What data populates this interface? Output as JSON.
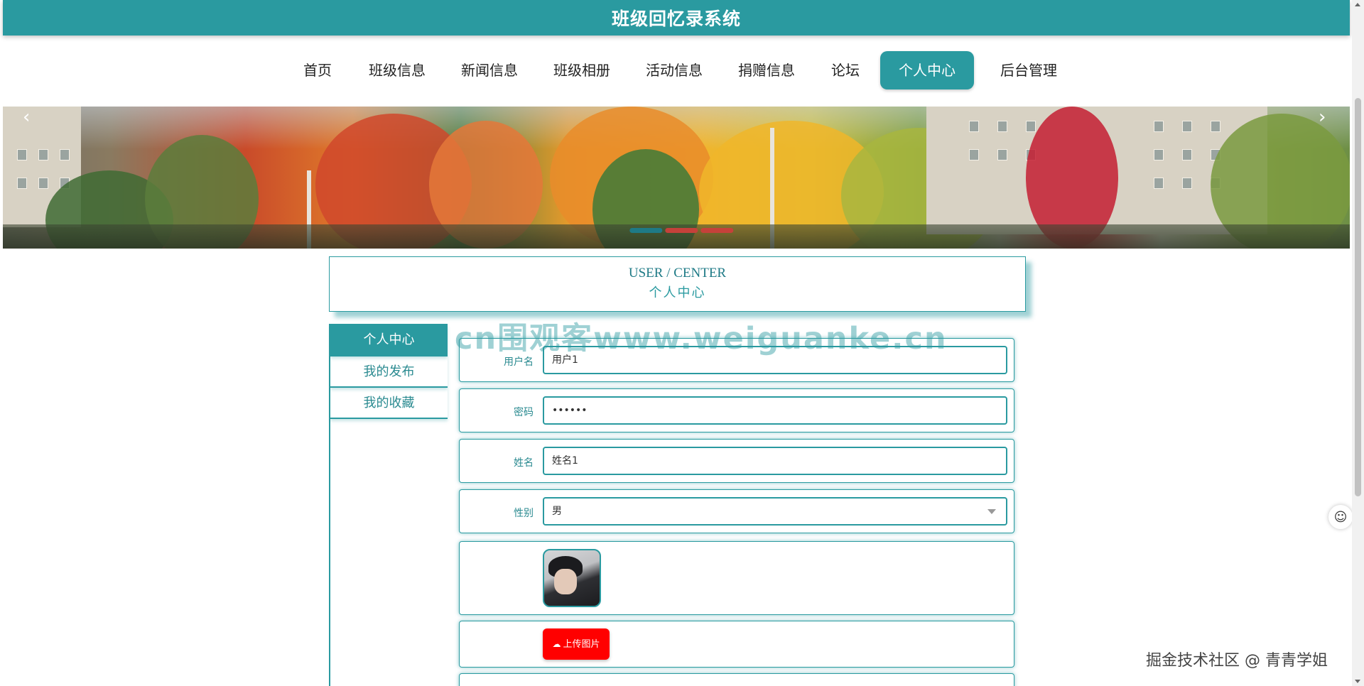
{
  "header": {
    "app_title": "班级回忆录系统"
  },
  "nav": {
    "items": [
      {
        "label": "首页",
        "active": false
      },
      {
        "label": "班级信息",
        "active": false
      },
      {
        "label": "新闻信息",
        "active": false
      },
      {
        "label": "班级相册",
        "active": false
      },
      {
        "label": "活动信息",
        "active": false
      },
      {
        "label": "捐赠信息",
        "active": false
      },
      {
        "label": "论坛",
        "active": false
      },
      {
        "label": "个人中心",
        "active": true
      },
      {
        "label": "后台管理",
        "active": false
      }
    ]
  },
  "banner": {
    "prev_icon": "‹",
    "next_icon": "›",
    "slide_count": 3,
    "active_slide": 1
  },
  "section": {
    "title_en": "USER / CENTER",
    "title_cn": "个人中心"
  },
  "watermark": {
    "text": "cn围观客www.weiguanke.cn"
  },
  "sidebar": {
    "items": [
      {
        "label": "个人中心",
        "active": true
      },
      {
        "label": "我的发布",
        "active": false
      },
      {
        "label": "我的收藏",
        "active": false
      }
    ]
  },
  "form": {
    "username_label": "用户名",
    "username_value": "用户1",
    "password_label": "密码",
    "password_value": "••••••",
    "name_label": "姓名",
    "name_value": "姓名1",
    "gender_label": "性别",
    "gender_value": "男",
    "upload_label": "上传图片"
  },
  "credit": {
    "text": "掘金技术社区 @ 青青学姐"
  },
  "colors": {
    "primary": "#2a9aa0",
    "upload": "#ff0000"
  }
}
